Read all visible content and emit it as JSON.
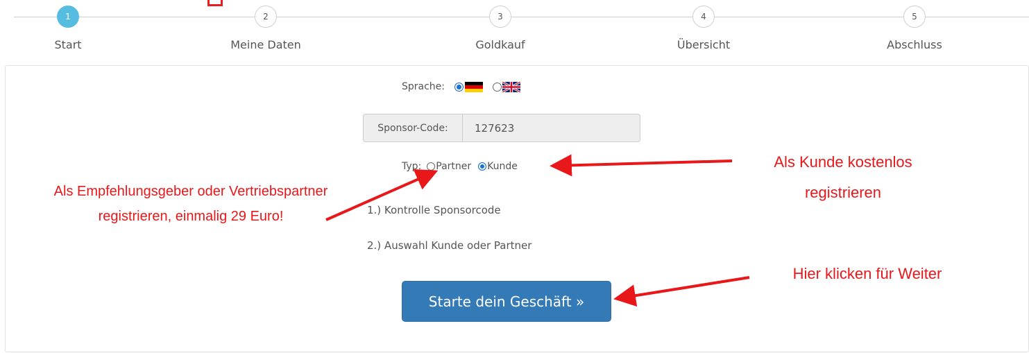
{
  "stepper": {
    "steps": [
      {
        "number": "1",
        "label": "Start"
      },
      {
        "number": "2",
        "label": "Meine Daten"
      },
      {
        "number": "3",
        "label": "Goldkauf"
      },
      {
        "number": "4",
        "label": "Übersicht"
      },
      {
        "number": "5",
        "label": "Abschluss"
      }
    ],
    "active_step": 1
  },
  "language": {
    "label": "Sprache:",
    "options": [
      "german-flag-icon",
      "uk-flag-icon"
    ],
    "selected": "german-flag-icon"
  },
  "sponsor": {
    "label": "Sponsor-Code:",
    "value": "127623"
  },
  "type": {
    "label": "Typ:",
    "options": [
      "Partner",
      "Kunde"
    ],
    "selected": "Kunde"
  },
  "info": {
    "line1": "1.) Kontrolle Sponsorcode",
    "line2": "2.) Auswahl Kunde oder Partner"
  },
  "cta": {
    "label": "Starte dein Geschäft »"
  },
  "annotations": {
    "partner_line1": "Als Empfehlungsgeber oder Vertriebspartner",
    "partner_line2": "registrieren, einmalig 29 Euro!",
    "customer_line1": "Als Kunde kostenlos",
    "customer_line2": "registrieren",
    "next": "Hier klicken für Weiter"
  },
  "colors": {
    "active_step": "#56bde0",
    "primary_button": "#337ab7",
    "annotation_red": "#e8171a",
    "radio_checked": "#1a6fd6"
  }
}
